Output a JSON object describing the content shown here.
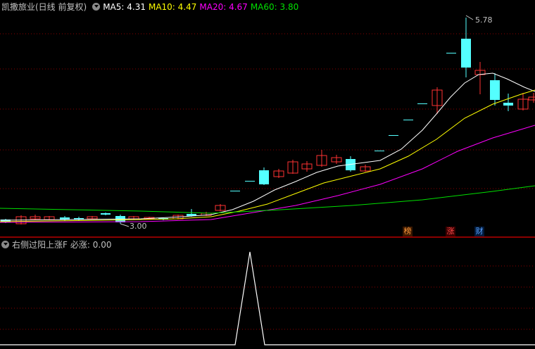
{
  "main": {
    "title": "凯撒旅业(日线 前复权)",
    "indicators": [
      {
        "label": "MA5: 4.31",
        "color": "#ffffff"
      },
      {
        "label": "MA10: 4.47",
        "color": "#ffff00"
      },
      {
        "label": "MA20: 4.67",
        "color": "#ff00ff"
      },
      {
        "label": "MA60: 3.80",
        "color": "#00e000"
      }
    ],
    "high_label": "5.78",
    "low_label": "3.00",
    "badges": [
      {
        "text": "榜",
        "color": "#ff9a3c"
      },
      {
        "text": "涨",
        "color": "#ff4a4a"
      },
      {
        "text": "财",
        "color": "#5aa0ff"
      }
    ]
  },
  "sub": {
    "title": "右侧过阳上涨F",
    "value_label": "必涨: 0.00",
    "signal_value": 1
  },
  "colors": {
    "up": "#ff3232",
    "down": "#54ffff",
    "grid": "#8b0000",
    "text": "#c0c0c0"
  }
}
